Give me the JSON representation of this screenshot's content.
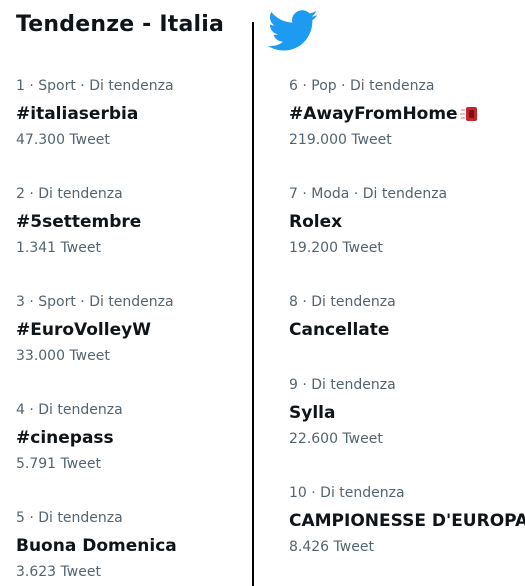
{
  "header": {
    "title": "Tendenze - Italia"
  },
  "brand": {
    "icon": "twitter-bird-icon",
    "color": "#1d9bf0"
  },
  "colors": {
    "text_primary": "#0f1419",
    "text_secondary": "#536471",
    "divider": "#000000"
  },
  "trends": [
    {
      "meta": "1 · Sport · Di tendenza",
      "name": "#italiaserbia",
      "count": "47.300 Tweet"
    },
    {
      "meta": "2 · Di tendenza",
      "name": "#5settembre",
      "count": "1.341 Tweet"
    },
    {
      "meta": "3 · Sport · Di tendenza",
      "name": "#EuroVolleyW",
      "count": "33.000 Tweet"
    },
    {
      "meta": "4 · Di tendenza",
      "name": "#cinepass",
      "count": "5.791 Tweet"
    },
    {
      "meta": "5 · Di tendenza",
      "name": "Buona Domenica",
      "count": "3.623 Tweet"
    },
    {
      "meta": "6 · Pop · Di tendenza",
      "name": "#AwayFromHome",
      "count": "219.000 Tweet",
      "icon": "away-from-home-emoji-icon"
    },
    {
      "meta": "7 · Moda · Di tendenza",
      "name": "Rolex",
      "count": "19.200 Tweet"
    },
    {
      "meta": "8 · Di tendenza",
      "name": "Cancellate"
    },
    {
      "meta": "9 · Di tendenza",
      "name": "Sylla",
      "count": "22.600 Tweet"
    },
    {
      "meta": "10 · Di tendenza",
      "name": "CAMPIONESSE D'EUROPA",
      "count": "8.426 Tweet"
    }
  ]
}
